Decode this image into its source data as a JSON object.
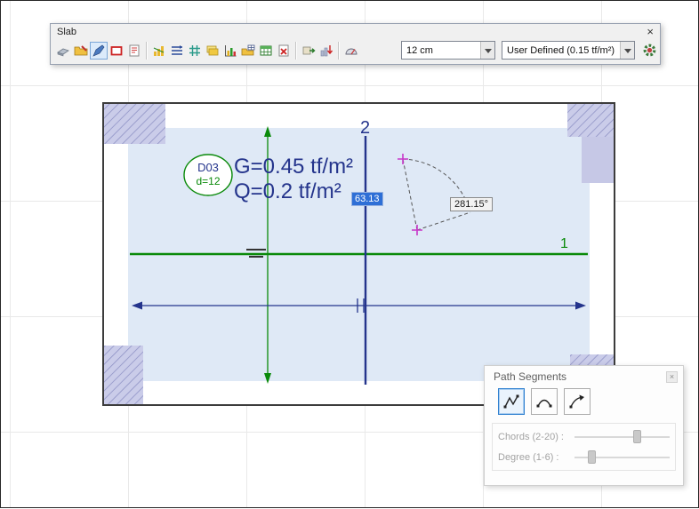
{
  "slab_window": {
    "title": "Slab",
    "close_label": "×",
    "thickness_combo_value": "12 cm",
    "load_combo_value": "User Defined  (0.15 tf/m²)",
    "icon_names": [
      "select",
      "open-edit",
      "draw-slab",
      "slab-outline",
      "report",
      "diagram",
      "reinforcement",
      "mesh",
      "layers",
      "chart",
      "open-table",
      "table",
      "delete-doc",
      "export",
      "import",
      "protractor",
      "settings-gear"
    ]
  },
  "drawing": {
    "slab_label_line1": "D03",
    "slab_label_line2": "d=12",
    "g_load_text": "G=0.45 tf/m²",
    "q_load_text": "Q=0.2 tf/m²",
    "axis_label_1": "1",
    "axis_label_2": "2",
    "length_edit_value": "63.13",
    "angle_readout": "281.15°"
  },
  "path_segments": {
    "title": "Path Segments",
    "close_label": "×",
    "chords_label": "Chords (2-20) :",
    "degree_label": "Degree (1-6) :",
    "chords_thumb_percent": 62,
    "degree_thumb_percent": 14
  },
  "colors": {
    "axis_green": "#0a8a0a",
    "axis_navy": "#24348c",
    "selection_blue": "#2e6fd6",
    "column_lavender": "#cacce9",
    "slab_fill_blue": "#dfe9f6",
    "marker_magenta": "#c837c8"
  }
}
